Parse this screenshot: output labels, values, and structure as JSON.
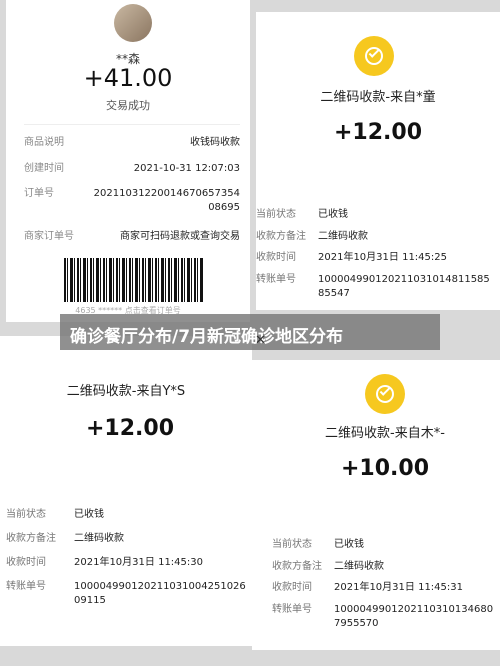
{
  "banner": {
    "text": "确诊餐厅分布/7月新冠确诊地区分布"
  },
  "card1": {
    "name": "**森",
    "amount": "+41.00",
    "status": "交易成功",
    "rows": [
      {
        "label": "商品说明",
        "value": "收钱码收款"
      },
      {
        "label": "创建时间",
        "value": "2021-10-31 12:07:03"
      },
      {
        "label": "订单号",
        "value": "20211031220014670657354086​95"
      },
      {
        "label": "商家订单号",
        "value": "商家可扫码退款或查询交易"
      }
    ],
    "barcode_caption": "4635 ****** 点击查看订单号"
  },
  "card2": {
    "title": "二维码收款-来自*童",
    "amount": "+12.00",
    "rows": [
      {
        "label": "当前状态",
        "value": "已收钱"
      },
      {
        "label": "收款方备注",
        "value": "二维码收款"
      },
      {
        "label": "收款时间",
        "value": "2021年10月31日 11:45:25"
      },
      {
        "label": "转账单号",
        "value": "100004990120211031014811585855​47"
      }
    ]
  },
  "card3": {
    "title": "二维码收款-来自Y*S",
    "amount": "+12.00",
    "rows": [
      {
        "label": "当前状态",
        "value": "已收钱"
      },
      {
        "label": "收款方备注",
        "value": "二维码收款"
      },
      {
        "label": "收款时间",
        "value": "2021年10月31日 11:45:30"
      },
      {
        "label": "转账单号",
        "value": "100004990120211031004251026​09115"
      }
    ]
  },
  "card4": {
    "title": "二维码收款-来自木*-",
    "amount": "+10.00",
    "rows": [
      {
        "label": "当前状态",
        "value": "已收钱"
      },
      {
        "label": "收款方备注",
        "value": "二维码收款"
      },
      {
        "label": "收款时间",
        "value": "2021年10月31日 11:45:31"
      },
      {
        "label": "转账单号",
        "value": "100004990120211031013468079​55570"
      }
    ]
  }
}
